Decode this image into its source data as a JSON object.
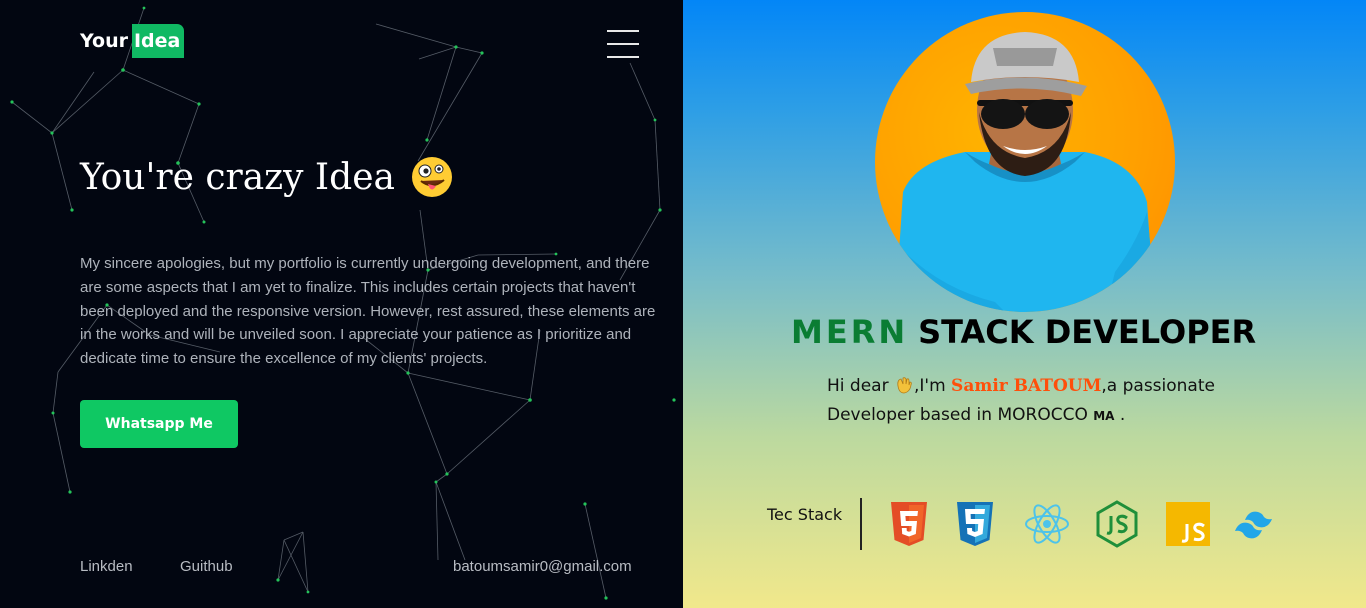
{
  "header": {
    "logo_part1": "Your",
    "logo_part2": "Idea",
    "menu_icon": "hamburger-icon"
  },
  "hero": {
    "title": "You're crazy Idea",
    "title_emoji": "zany-face-emoji",
    "description": "My sincere apologies, but my portfolio is currently undergoing development, and there are some aspects that I am yet to finalize. This includes certain projects that haven't been deployed and the responsive version. However, rest assured, these elements are in the works and will be unveiled soon. I appreciate your patience as I prioritize and dedicate time to ensure the excellence of my clients' projects.",
    "cta_label": "Whatsapp Me"
  },
  "footer": {
    "linkedin": "Linkden",
    "github": "Guithub",
    "email": "batoumsamir0@gmail.com"
  },
  "profile": {
    "role_highlight": "MERN",
    "role_rest": "STACK DEVELOPER",
    "intro_prefix": "Hi dear",
    "intro_im": ",I'm",
    "name": "Samir BATOUM",
    "intro_suffix": ",a passionate Developer based in MOROCCO",
    "country_code": "MA",
    "intro_end": ".",
    "tec_stack_label": "Tec Stack",
    "tech_icons": [
      "html5-icon",
      "css3-icon",
      "react-icon",
      "nodejs-icon",
      "javascript-icon",
      "tailwind-icon"
    ]
  },
  "colors": {
    "accent_green": "#0fc863",
    "left_background": "#020611",
    "name_orange": "#ff4f0a",
    "mern_green": "#0a7d33"
  }
}
